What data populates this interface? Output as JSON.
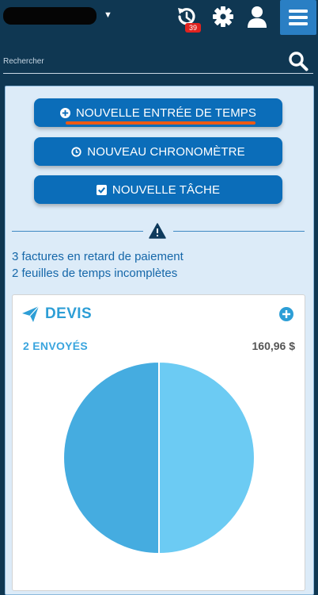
{
  "header": {
    "history_badge": "39",
    "icons": [
      "history-icon",
      "gear-icon",
      "user-icon",
      "hamburger-menu-icon"
    ],
    "menu_button_color": "#2a7fc4"
  },
  "search": {
    "placeholder": "Rechercher"
  },
  "actions": {
    "new_time_entry": "NOUVELLE ENTRÉE DE TEMPS",
    "new_timer": "NOUVEAU CHRONOMÈTRE",
    "new_task": "NOUVELLE TÂCHE",
    "button_color": "#0b6db9"
  },
  "alerts": {
    "items": [
      "3 factures en retard de paiement",
      "2 feuilles de temps incomplètes"
    ]
  },
  "quotes_card": {
    "title": "DEVIS",
    "sent_label": "2 ENVOYÉS",
    "amount": "160,96 $"
  },
  "chart_data": {
    "type": "pie",
    "title": "",
    "values": [
      50,
      50
    ],
    "colors": [
      "#6ccbf3",
      "#45ace0"
    ]
  }
}
